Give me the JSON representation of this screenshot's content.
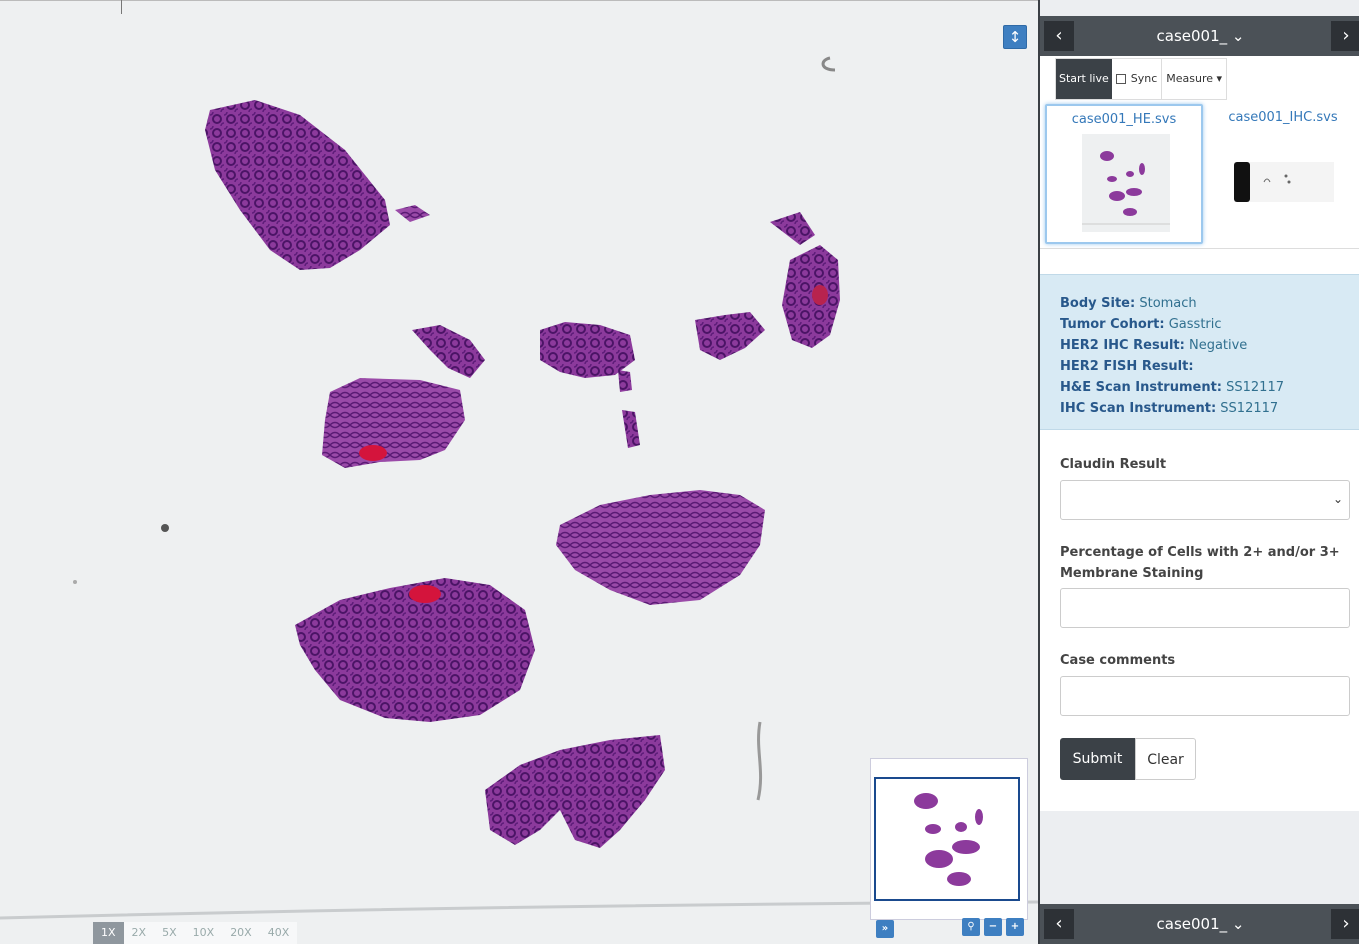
{
  "viewer": {
    "zoom_levels": [
      "1X",
      "2X",
      "5X",
      "10X",
      "20X",
      "40X"
    ],
    "active_zoom": "1X",
    "vertical_icon": "↕",
    "overview_icons": {
      "toggle": "»",
      "pin": "⚲",
      "zoom_out": "−",
      "zoom_in": "+"
    }
  },
  "panel": {
    "header_title": "case001_",
    "footer_title": "case001_",
    "prev_icon": "‹",
    "next_icon": "›",
    "dropdown_icon": "⌄",
    "toolbar": {
      "start_live": "Start live",
      "sync": "Sync",
      "measure": "Measure ▾"
    },
    "slides": [
      {
        "name": "case001_HE.svs",
        "selected": true
      },
      {
        "name": "case001_IHC.svs",
        "selected": false
      }
    ],
    "info": [
      {
        "label": "Body Site:",
        "value": "Stomach"
      },
      {
        "label": "Tumor Cohort:",
        "value": "Gasstric"
      },
      {
        "label": "HER2 IHC Result:",
        "value": "Negative"
      },
      {
        "label": "HER2 FISH Result:",
        "value": ""
      },
      {
        "label": "H&E Scan Instrument:",
        "value": "SS12117"
      },
      {
        "label": "IHC Scan Instrument:",
        "value": "SS12117"
      }
    ],
    "form": {
      "claudin_label": "Claudin Result",
      "claudin_value": "",
      "percentage_label_1": "Percentage of Cells with 2+ and/or 3+",
      "percentage_label_2": "Membrane Staining",
      "percentage_value": "",
      "comments_label": "Case comments",
      "comments_value": "",
      "submit_label": "Submit",
      "clear_label": "Clear"
    }
  }
}
